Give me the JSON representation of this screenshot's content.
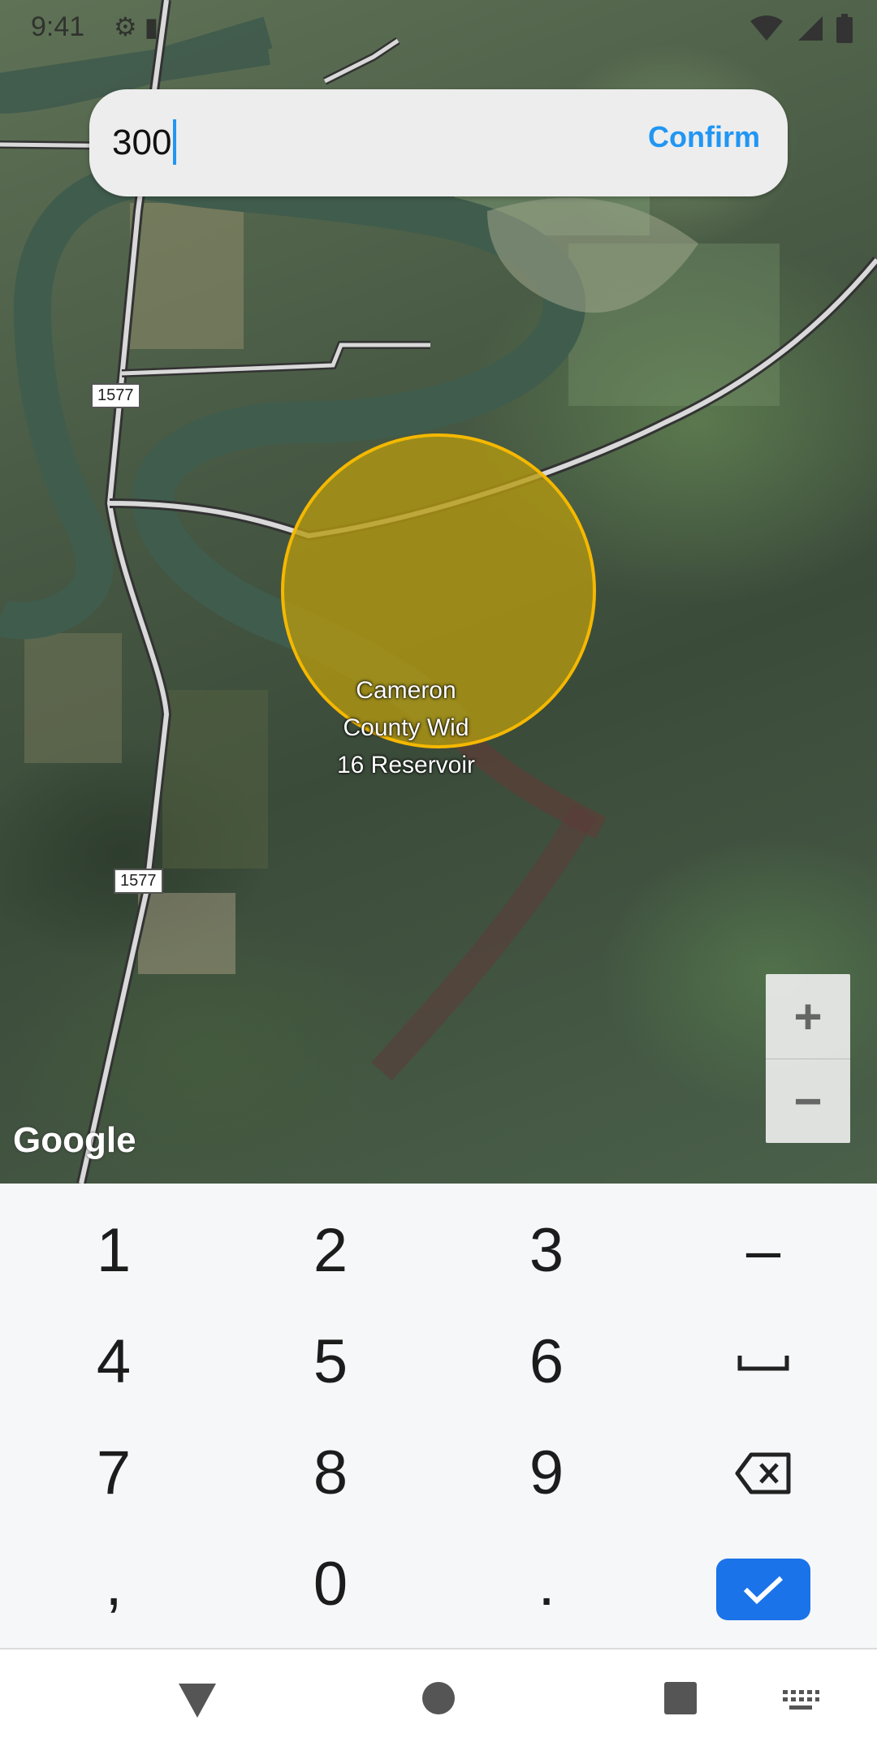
{
  "status_bar": {
    "time": "9:41",
    "left_icons": [
      "gear-icon",
      "sim-card-icon"
    ],
    "right_icons": [
      "wifi-icon",
      "signal-icon",
      "battery-icon"
    ]
  },
  "input_bar": {
    "value": "300",
    "confirm_label": "Confirm",
    "accent_color": "#2196f3"
  },
  "map": {
    "road_shields": [
      "1577",
      "1577"
    ],
    "place_label": [
      "Cameron",
      "County Wid",
      "16 Reservoir"
    ],
    "logo_text": "Google",
    "circle_fill_color": "#b59a10",
    "circle_stroke_color": "#f5b800",
    "zoom_in_label": "+",
    "zoom_out_label": "−"
  },
  "keyboard": {
    "rows": [
      [
        "1",
        "2",
        "3",
        "–"
      ],
      [
        "4",
        "5",
        "6",
        "space-icon"
      ],
      [
        "7",
        "8",
        "9",
        "backspace-icon"
      ],
      [
        ",",
        "0",
        ".",
        "done-check-icon"
      ]
    ],
    "labels": {
      "k1": "1",
      "k2": "2",
      "k3": "3",
      "dash": "–",
      "k4": "4",
      "k5": "5",
      "k6": "6",
      "k7": "7",
      "k8": "8",
      "k9": "9",
      "comma": ",",
      "k0": "0",
      "period": "."
    },
    "done_color": "#1a73e8"
  },
  "nav_bar": {
    "buttons": [
      "back-icon",
      "home-icon",
      "recents-icon",
      "keyboard-switch-icon"
    ]
  }
}
